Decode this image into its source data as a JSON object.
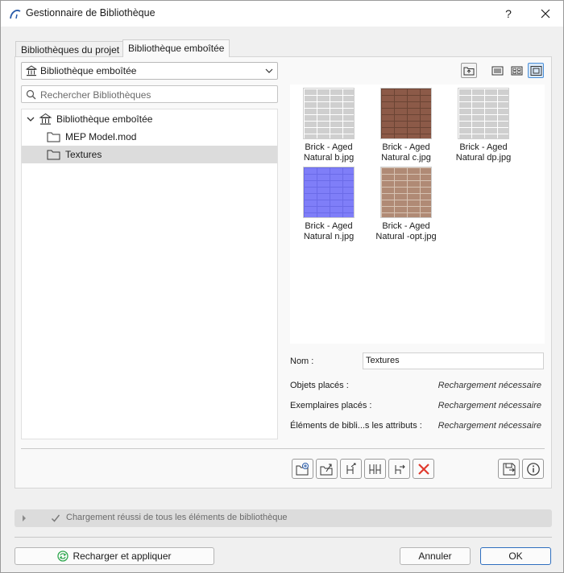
{
  "window": {
    "title": "Gestionnaire de Bibliothèque",
    "help_label": "?",
    "colors": {
      "selection": "#dcdcdc",
      "accent": "#2f6fbf",
      "error": "#e03a2e",
      "success": "#2fa84f"
    }
  },
  "tabs": [
    {
      "label": "Bibliothèques du projet",
      "active": false
    },
    {
      "label": "Bibliothèque emboîtée",
      "active": true
    }
  ],
  "library_select": {
    "value": "Bibliothèque emboîtée",
    "icon": "library-icon"
  },
  "search": {
    "placeholder": "Rechercher Bibliothèques"
  },
  "tree": {
    "root": {
      "label": "Bibliothèque emboîtée",
      "icon": "library-icon",
      "expanded": true
    },
    "children": [
      {
        "label": "MEP Model.mod",
        "icon": "folder-icon",
        "selected": false
      },
      {
        "label": "Textures",
        "icon": "folder-icon",
        "selected": true
      }
    ]
  },
  "thumbnails": [
    {
      "caption_line1": "Brick - Aged",
      "caption_line2": "Natural b.jpg",
      "texture": "grey"
    },
    {
      "caption_line1": "Brick - Aged",
      "caption_line2": "Natural c.jpg",
      "texture": "red"
    },
    {
      "caption_line1": "Brick - Aged",
      "caption_line2": "Natural dp.jpg",
      "texture": "grey"
    },
    {
      "caption_line1": "Brick - Aged",
      "caption_line2": "Natural n.jpg",
      "texture": "blue"
    },
    {
      "caption_line1": "Brick - Aged",
      "caption_line2": "Natural -opt.jpg",
      "texture": "tan"
    }
  ],
  "properties": {
    "name_label": "Nom :",
    "name_value": "Textures",
    "rows": [
      {
        "label": "Objets placés :",
        "value": "Rechargement nécessaire"
      },
      {
        "label": "Exemplaires placés :",
        "value": "Rechargement nécessaire"
      },
      {
        "label": "Éléments de bibli...s les attributs :",
        "value": "Rechargement nécessaire"
      }
    ]
  },
  "status": {
    "text": "Chargement réussi de tous les éléments de bibliothèque"
  },
  "buttons": {
    "reload_apply": "Recharger et appliquer",
    "cancel": "Annuler",
    "ok": "OK"
  }
}
